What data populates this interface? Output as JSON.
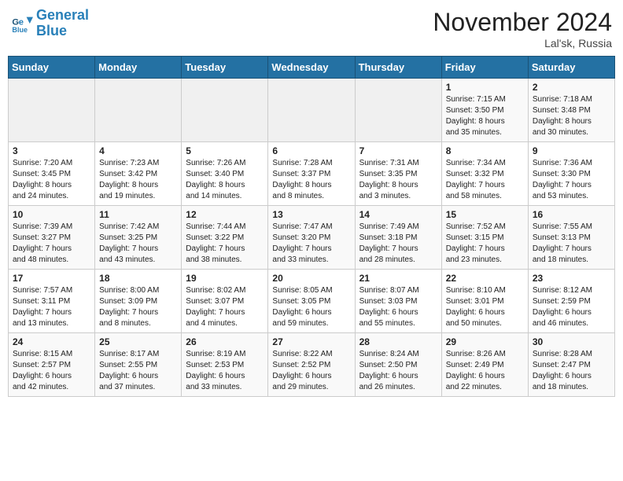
{
  "header": {
    "logo_line1": "General",
    "logo_line2": "Blue",
    "month_year": "November 2024",
    "location": "Lal'sk, Russia"
  },
  "weekdays": [
    "Sunday",
    "Monday",
    "Tuesday",
    "Wednesday",
    "Thursday",
    "Friday",
    "Saturday"
  ],
  "weeks": [
    [
      {
        "day": "",
        "info": ""
      },
      {
        "day": "",
        "info": ""
      },
      {
        "day": "",
        "info": ""
      },
      {
        "day": "",
        "info": ""
      },
      {
        "day": "",
        "info": ""
      },
      {
        "day": "1",
        "info": "Sunrise: 7:15 AM\nSunset: 3:50 PM\nDaylight: 8 hours\nand 35 minutes."
      },
      {
        "day": "2",
        "info": "Sunrise: 7:18 AM\nSunset: 3:48 PM\nDaylight: 8 hours\nand 30 minutes."
      }
    ],
    [
      {
        "day": "3",
        "info": "Sunrise: 7:20 AM\nSunset: 3:45 PM\nDaylight: 8 hours\nand 24 minutes."
      },
      {
        "day": "4",
        "info": "Sunrise: 7:23 AM\nSunset: 3:42 PM\nDaylight: 8 hours\nand 19 minutes."
      },
      {
        "day": "5",
        "info": "Sunrise: 7:26 AM\nSunset: 3:40 PM\nDaylight: 8 hours\nand 14 minutes."
      },
      {
        "day": "6",
        "info": "Sunrise: 7:28 AM\nSunset: 3:37 PM\nDaylight: 8 hours\nand 8 minutes."
      },
      {
        "day": "7",
        "info": "Sunrise: 7:31 AM\nSunset: 3:35 PM\nDaylight: 8 hours\nand 3 minutes."
      },
      {
        "day": "8",
        "info": "Sunrise: 7:34 AM\nSunset: 3:32 PM\nDaylight: 7 hours\nand 58 minutes."
      },
      {
        "day": "9",
        "info": "Sunrise: 7:36 AM\nSunset: 3:30 PM\nDaylight: 7 hours\nand 53 minutes."
      }
    ],
    [
      {
        "day": "10",
        "info": "Sunrise: 7:39 AM\nSunset: 3:27 PM\nDaylight: 7 hours\nand 48 minutes."
      },
      {
        "day": "11",
        "info": "Sunrise: 7:42 AM\nSunset: 3:25 PM\nDaylight: 7 hours\nand 43 minutes."
      },
      {
        "day": "12",
        "info": "Sunrise: 7:44 AM\nSunset: 3:22 PM\nDaylight: 7 hours\nand 38 minutes."
      },
      {
        "day": "13",
        "info": "Sunrise: 7:47 AM\nSunset: 3:20 PM\nDaylight: 7 hours\nand 33 minutes."
      },
      {
        "day": "14",
        "info": "Sunrise: 7:49 AM\nSunset: 3:18 PM\nDaylight: 7 hours\nand 28 minutes."
      },
      {
        "day": "15",
        "info": "Sunrise: 7:52 AM\nSunset: 3:15 PM\nDaylight: 7 hours\nand 23 minutes."
      },
      {
        "day": "16",
        "info": "Sunrise: 7:55 AM\nSunset: 3:13 PM\nDaylight: 7 hours\nand 18 minutes."
      }
    ],
    [
      {
        "day": "17",
        "info": "Sunrise: 7:57 AM\nSunset: 3:11 PM\nDaylight: 7 hours\nand 13 minutes."
      },
      {
        "day": "18",
        "info": "Sunrise: 8:00 AM\nSunset: 3:09 PM\nDaylight: 7 hours\nand 8 minutes."
      },
      {
        "day": "19",
        "info": "Sunrise: 8:02 AM\nSunset: 3:07 PM\nDaylight: 7 hours\nand 4 minutes."
      },
      {
        "day": "20",
        "info": "Sunrise: 8:05 AM\nSunset: 3:05 PM\nDaylight: 6 hours\nand 59 minutes."
      },
      {
        "day": "21",
        "info": "Sunrise: 8:07 AM\nSunset: 3:03 PM\nDaylight: 6 hours\nand 55 minutes."
      },
      {
        "day": "22",
        "info": "Sunrise: 8:10 AM\nSunset: 3:01 PM\nDaylight: 6 hours\nand 50 minutes."
      },
      {
        "day": "23",
        "info": "Sunrise: 8:12 AM\nSunset: 2:59 PM\nDaylight: 6 hours\nand 46 minutes."
      }
    ],
    [
      {
        "day": "24",
        "info": "Sunrise: 8:15 AM\nSunset: 2:57 PM\nDaylight: 6 hours\nand 42 minutes."
      },
      {
        "day": "25",
        "info": "Sunrise: 8:17 AM\nSunset: 2:55 PM\nDaylight: 6 hours\nand 37 minutes."
      },
      {
        "day": "26",
        "info": "Sunrise: 8:19 AM\nSunset: 2:53 PM\nDaylight: 6 hours\nand 33 minutes."
      },
      {
        "day": "27",
        "info": "Sunrise: 8:22 AM\nSunset: 2:52 PM\nDaylight: 6 hours\nand 29 minutes."
      },
      {
        "day": "28",
        "info": "Sunrise: 8:24 AM\nSunset: 2:50 PM\nDaylight: 6 hours\nand 26 minutes."
      },
      {
        "day": "29",
        "info": "Sunrise: 8:26 AM\nSunset: 2:49 PM\nDaylight: 6 hours\nand 22 minutes."
      },
      {
        "day": "30",
        "info": "Sunrise: 8:28 AM\nSunset: 2:47 PM\nDaylight: 6 hours\nand 18 minutes."
      }
    ]
  ]
}
